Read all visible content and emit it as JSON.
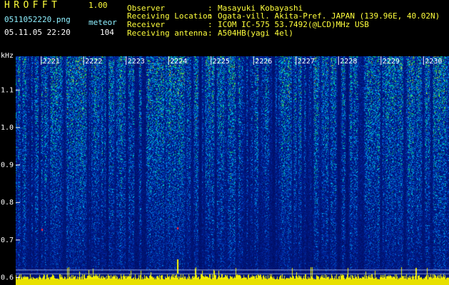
{
  "app": {
    "title": "HROFFT",
    "version": "1.00",
    "file_name": "0511052220.png",
    "mode": "meteor",
    "datetime": "05.11.05 22:20",
    "count": "104"
  },
  "info": [
    {
      "label": "Observer",
      "value": "Masayuki Kobayashi"
    },
    {
      "label": "Receiving Location",
      "value": "Ogata-vill. Akita-Pref. JAPAN (139.96E, 40.02N)"
    },
    {
      "label": "Receiver",
      "value": "ICOM IC-575 53.7492(@LCD)MHz USB"
    },
    {
      "label": "Receiving antenna",
      "value": "A504HB(yagi 4el)"
    }
  ],
  "chart_data": {
    "type": "heatmap",
    "ylabel": "kHz",
    "yticks": [
      {
        "value": 1.1,
        "label": "1.1"
      },
      {
        "value": 1.0,
        "label": "1.0"
      },
      {
        "value": 0.9,
        "label": "0.9"
      },
      {
        "value": 0.8,
        "label": "0.8"
      },
      {
        "value": 0.7,
        "label": "0.7"
      },
      {
        "value": 0.6,
        "label": "0.6"
      }
    ],
    "ylim": [
      0.58,
      1.19
    ],
    "xticks": [
      {
        "value": 2221,
        "label": "2221"
      },
      {
        "value": 2222,
        "label": "2222"
      },
      {
        "value": 2223,
        "label": "2223"
      },
      {
        "value": 2224,
        "label": "2224"
      },
      {
        "value": 2225,
        "label": "2225"
      },
      {
        "value": 2226,
        "label": "2226"
      },
      {
        "value": 2227,
        "label": "2227"
      },
      {
        "value": 2228,
        "label": "2228"
      },
      {
        "value": 2229,
        "label": "2229"
      },
      {
        "value": 2230,
        "label": "2230"
      }
    ],
    "xlim": [
      2220.4,
      2230.6
    ],
    "grid": true,
    "colors": {
      "low": "#00106e",
      "mid": "#0090ff",
      "high": "#00e070",
      "peak": "#ffff00",
      "grid": "#ffffff",
      "meteor": "#ff2040"
    }
  }
}
